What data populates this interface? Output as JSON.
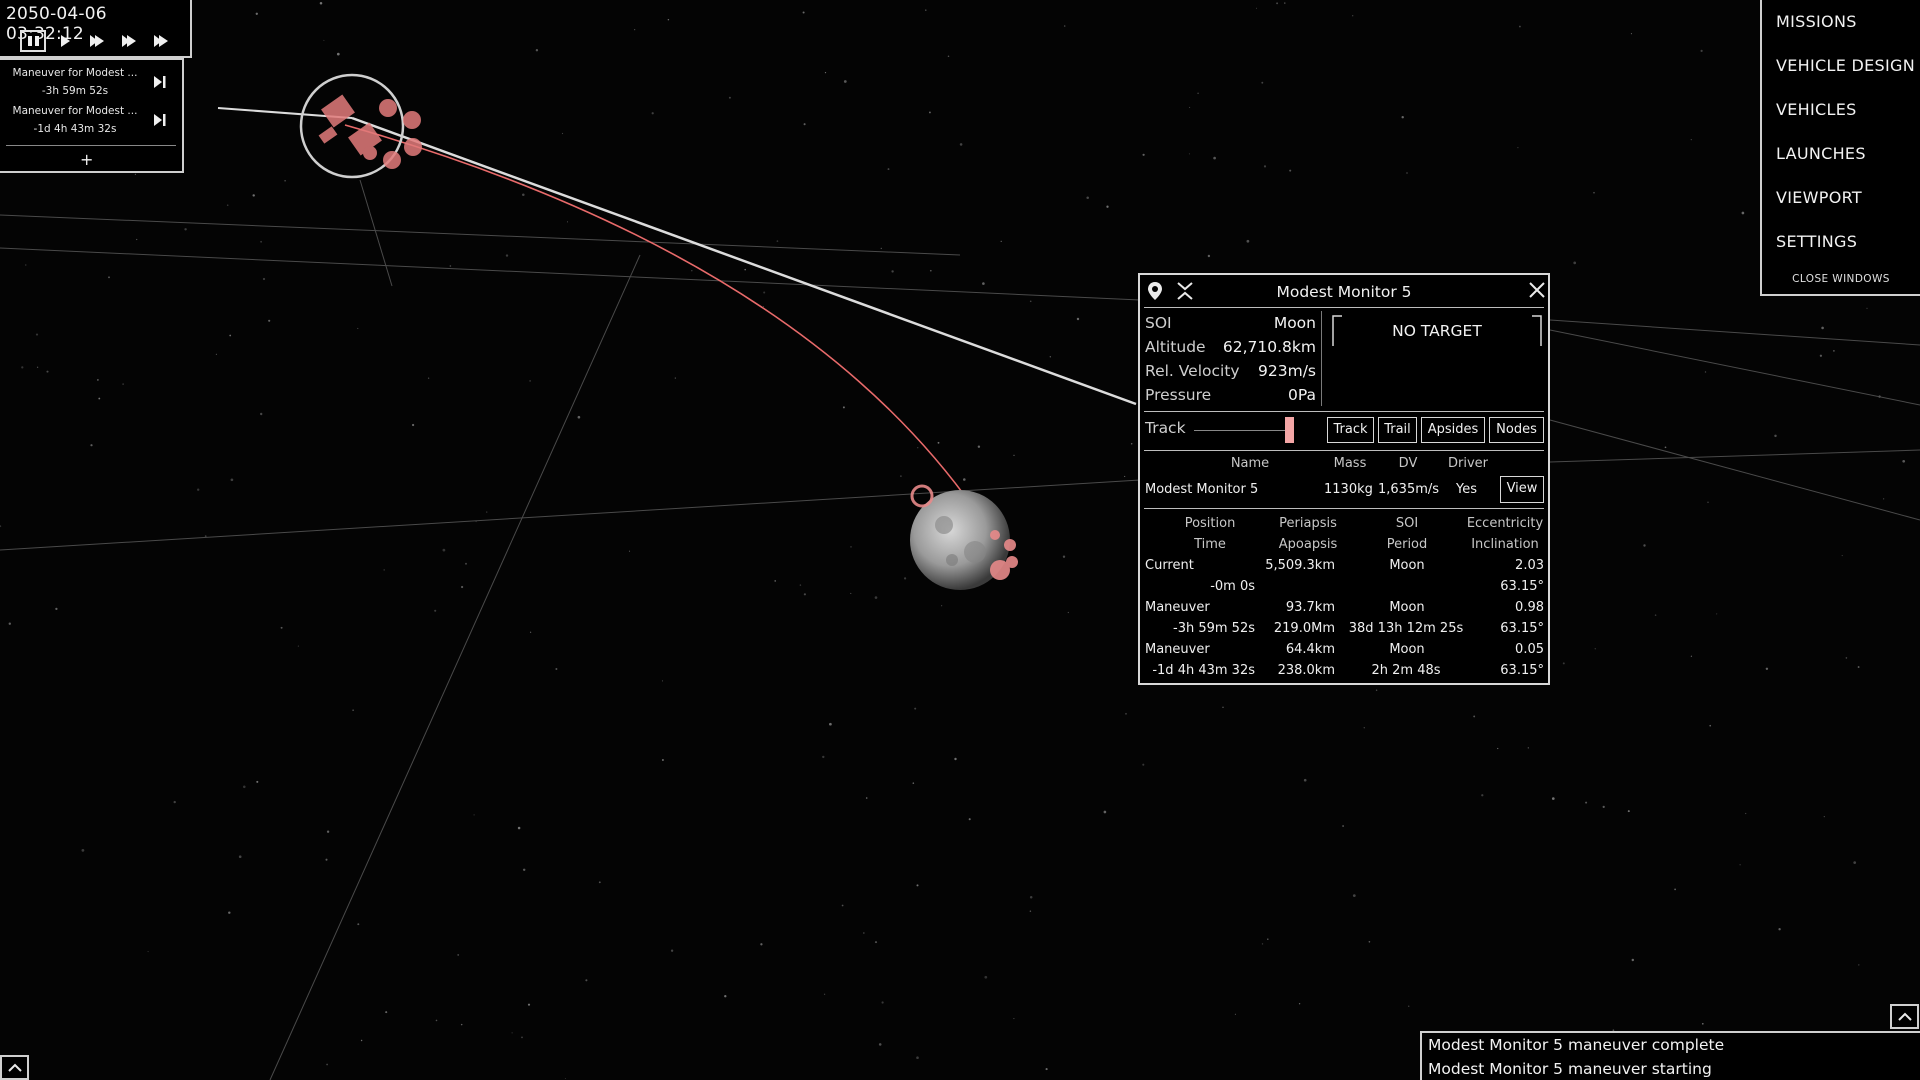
{
  "time_panel": {
    "datetime": "2050-04-06 03:32:12",
    "controls": [
      "pause-icon",
      "play-1x-icon",
      "play-2x-icon",
      "play-3x-icon",
      "play-4x-icon"
    ]
  },
  "maneuver_queue": {
    "items": [
      {
        "name": "Maneuver for Modest ...",
        "time": "-3h 59m 52s"
      },
      {
        "name": "Maneuver for Modest ...",
        "time": "-1d 4h 43m 32s"
      }
    ],
    "add_label": "+"
  },
  "menu": {
    "items": [
      "MISSIONS",
      "VEHICLE DESIGN",
      "VEHICLES",
      "LAUNCHES",
      "VIEWPORT",
      "SETTINGS"
    ],
    "close_label": "CLOSE WINDOWS"
  },
  "vessel_window": {
    "title": "Modest Monitor 5",
    "stats": [
      {
        "label": "SOI",
        "value": "Moon"
      },
      {
        "label": "Altitude",
        "value": "62,710.8km"
      },
      {
        "label": "Rel. Velocity",
        "value": "923m/s"
      },
      {
        "label": "Pressure",
        "value": "0Pa"
      }
    ],
    "target": "NO TARGET",
    "track_label": "Track",
    "buttons": [
      "Track",
      "Trail",
      "Apsides",
      "Nodes"
    ],
    "vehicle_headers": [
      "Name",
      "Mass",
      "DV",
      "Driver"
    ],
    "vehicle_row": {
      "name": "Modest Monitor 5",
      "mass": "1130kg",
      "dv": "1,635m/s",
      "driver": "Yes",
      "view": "View"
    },
    "orbit_headers": {
      "row1": [
        "Position",
        "Periapsis",
        "SOI",
        "Eccentricity"
      ],
      "row2": [
        "Time",
        "Apoapsis",
        "Period",
        "Inclination"
      ]
    },
    "orbit_rows": [
      {
        "position": "Current",
        "periapsis": "5,509.3km",
        "soi": "Moon",
        "ecc": "2.03",
        "time": "-0m 0s",
        "apoapsis": "",
        "period": "",
        "incl": "63.15°"
      },
      {
        "position": "Maneuver",
        "periapsis": "93.7km",
        "soi": "Moon",
        "ecc": "0.98",
        "time": "-3h 59m 52s",
        "apoapsis": "219.0Mm",
        "period": "38d 13h 12m 25s",
        "incl": "63.15°"
      },
      {
        "position": "Maneuver",
        "periapsis": "64.4km",
        "soi": "Moon",
        "ecc": "0.05",
        "time": "-1d 4h 43m 32s",
        "apoapsis": "238.0km",
        "period": "2h 2m 48s",
        "incl": "63.15°"
      }
    ]
  },
  "notifications": [
    "Modest Monitor 5 maneuver complete",
    "Modest Monitor 5 maneuver starting"
  ],
  "colors": {
    "accent": "#f4a6a6",
    "orbit_red": "#e86a6a",
    "panel_border": "#cfcfcf",
    "background": "#040404"
  }
}
